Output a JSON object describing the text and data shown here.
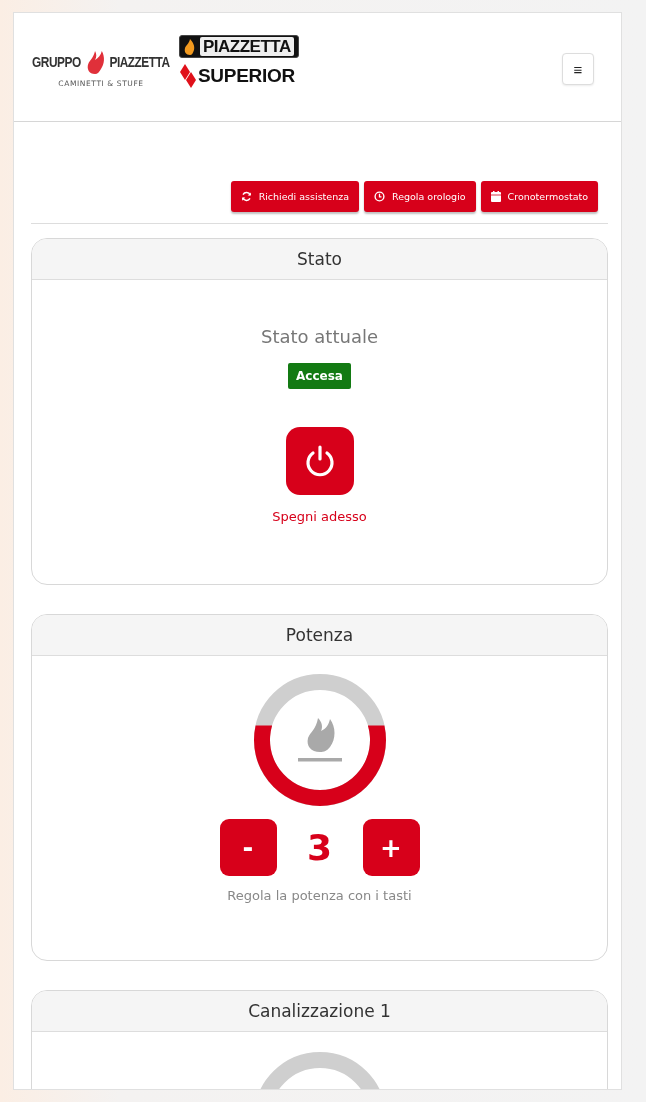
{
  "header": {
    "logo_group": {
      "left": "GRUPPO",
      "right": "PIAZZETTA",
      "tagline": "CAMINETTI & STUFE"
    },
    "brands": [
      "PIAZZETTA",
      "SUPERIOR"
    ],
    "menu_button": "≡"
  },
  "actions": [
    "Richiedi assistenza",
    "Regola orologio",
    "Cronotermostato"
  ],
  "stato": {
    "title": "Stato",
    "label": "Stato attuale",
    "value": "Accesa",
    "on": true,
    "action": "Spegni adesso"
  },
  "potenza": {
    "title": "Potenza",
    "level": 0.6,
    "minus": "-",
    "value": "3",
    "plus": "+",
    "hint": "Regola la potenza con i tasti"
  },
  "canalizzazione": {
    "title": "Canalizzazione 1"
  }
}
